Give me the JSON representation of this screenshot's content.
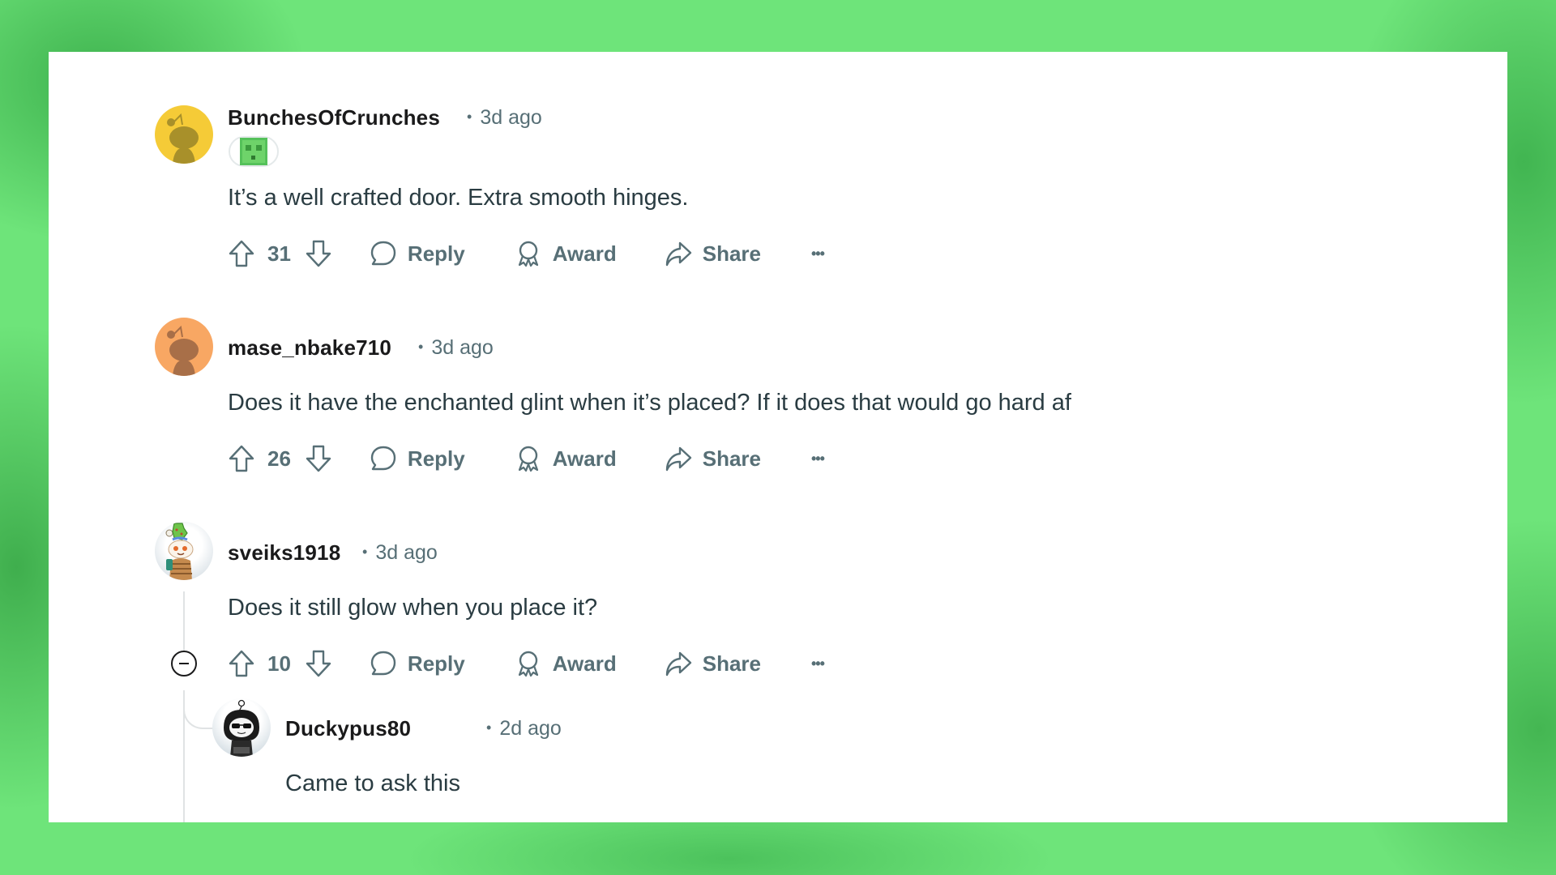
{
  "comments": [
    {
      "username": "BunchesOfCrunches",
      "separator": "•",
      "time": "3d ago",
      "flair": "minecraft-slime-flair",
      "body": "It’s a well crafted door. Extra smooth hinges.",
      "score": "31",
      "avatar_color": "#f5cb37",
      "avatar_icon": "snoo-silhouette-icon"
    },
    {
      "username": "mase_nbake710",
      "separator": "•",
      "time": "3d ago",
      "body": "Does it have the enchanted glint when it’s placed? If it does that would go hard af",
      "score": "26",
      "avatar_color": "#f8a763",
      "avatar_icon": "snoo-silhouette-icon"
    },
    {
      "username": "sveiks1918",
      "separator": "•",
      "time": "3d ago",
      "body": "Does it still glow when you place it?",
      "score": "10",
      "avatar_icon": "snoo-custom-avatar-icon"
    },
    {
      "username": "Duckypus80",
      "separator": "•",
      "time": "2d ago",
      "body": "Came to ask this",
      "avatar_icon": "snoo-hooded-sunglasses-avatar-icon"
    }
  ],
  "actions": {
    "reply": "Reply",
    "award": "Award",
    "share": "Share",
    "more": "•••"
  },
  "colors": {
    "background_green": "#6ee47a",
    "panel": "#ffffff",
    "username": "#1a1a1b",
    "meta": "#576f76",
    "body": "#2a3c42"
  }
}
